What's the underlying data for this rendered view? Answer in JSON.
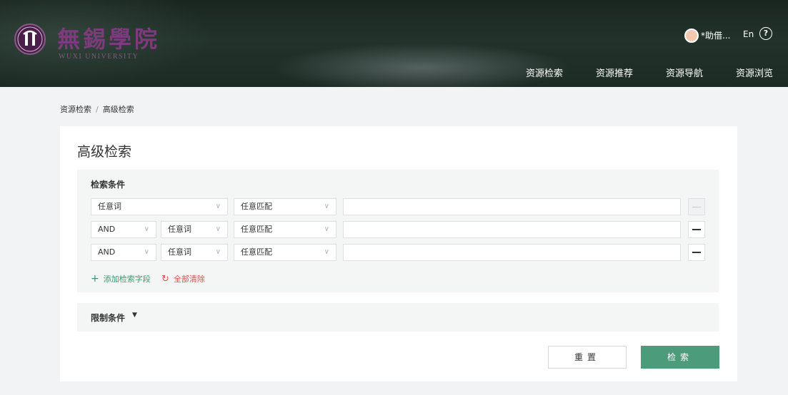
{
  "header": {
    "logo_cn": "無錫學院",
    "logo_en": "WUXI UNIVERSITY",
    "user_name": "*助借...",
    "lang": "En",
    "help": "?",
    "nav": [
      "资源检索",
      "资源推荐",
      "资源导航",
      "资源浏览"
    ]
  },
  "breadcrumb": {
    "items": [
      "资源检索",
      "高级检索"
    ],
    "sep": "/"
  },
  "page_title": "高级检索",
  "conditions": {
    "title": "检索条件",
    "rows": [
      {
        "logic": "",
        "field": "任意词",
        "match": "任意匹配",
        "value": ""
      },
      {
        "logic": "AND",
        "field": "任意词",
        "match": "任意匹配",
        "value": ""
      },
      {
        "logic": "AND",
        "field": "任意词",
        "match": "任意匹配",
        "value": ""
      }
    ],
    "add_field": "添加检索字段",
    "clear_all": "全部清除"
  },
  "limits": {
    "title": "限制条件"
  },
  "buttons": {
    "reset": "重置",
    "search": "检索"
  },
  "colors": {
    "accent": "#4c9c7c",
    "danger": "#e0514c",
    "logo": "#7d3a7d"
  }
}
